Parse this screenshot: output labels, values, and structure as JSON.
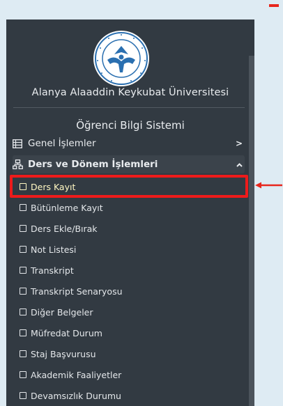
{
  "brand": {
    "university_name": "Alanya Alaaddin Keykubat Üniversitesi",
    "system_title": "Öğrenci Bilgi Sistemi",
    "logo_alt": "Alanya Alaaddin Keykubat Üniversitesi logo"
  },
  "menu": {
    "general": {
      "label": "Genel İşlemler",
      "icon": "grid-list-icon",
      "chevron": ">"
    },
    "courses": {
      "label": "Ders ve Dönem İşlemleri",
      "icon": "sitemap-icon",
      "chevron": "^"
    }
  },
  "submenu": [
    {
      "label": "Ders Kayıt",
      "active": true
    },
    {
      "label": "Bütünleme Kayıt"
    },
    {
      "label": "Ders Ekle/Bırak"
    },
    {
      "label": "Not Listesi"
    },
    {
      "label": "Transkript"
    },
    {
      "label": "Transkript Senaryosu"
    },
    {
      "label": "Diğer Belgeler"
    },
    {
      "label": "Müfredat Durum"
    },
    {
      "label": "Staj Başvurusu"
    },
    {
      "label": "Akademik Faaliyetler"
    },
    {
      "label": "Devamsızlık Durumu"
    }
  ],
  "colors": {
    "page_bg": "#deebf3",
    "sidebar_bg": "#323a42",
    "highlight_red": "#ee1b1b",
    "active_text": "#fff7c2"
  }
}
